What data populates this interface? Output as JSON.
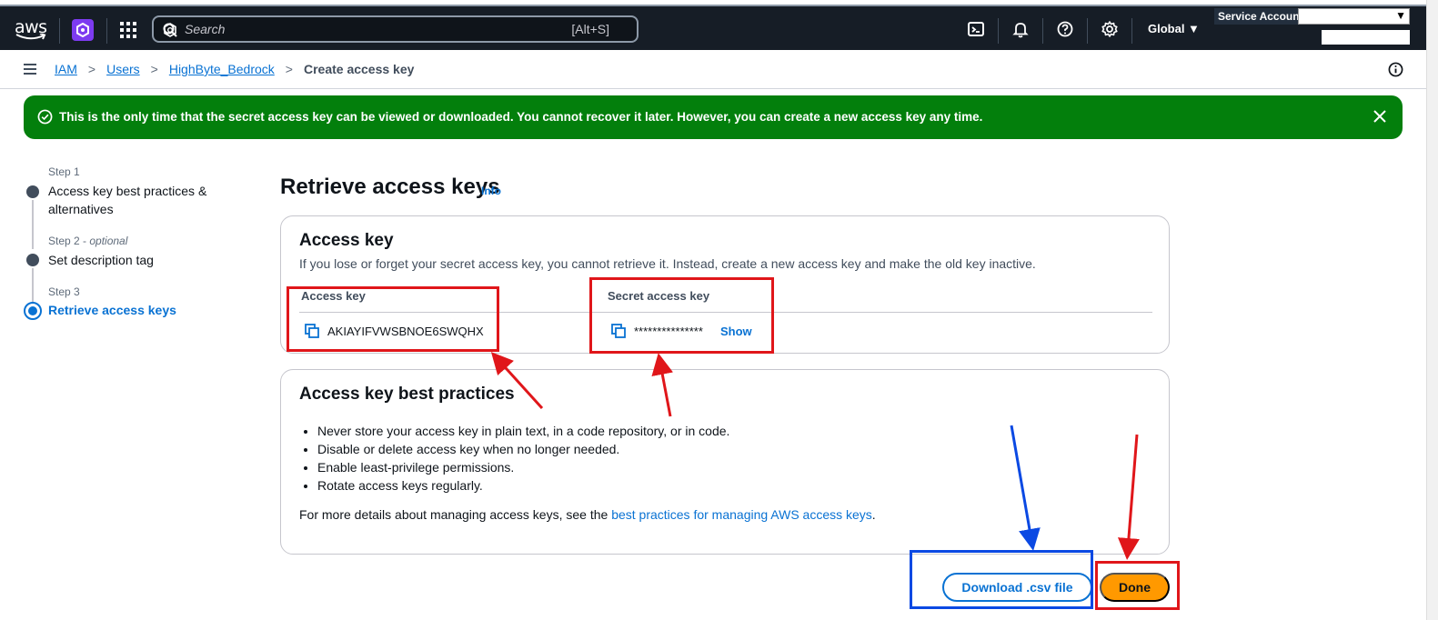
{
  "topnav": {
    "logo_text": "aws",
    "search_placeholder": "Search",
    "search_shortcut": "[Alt+S]",
    "region": "Global ▼",
    "account_label": "Service Account",
    "account_dropdown_arrow": "▼"
  },
  "breadcrumb": {
    "items": [
      "IAM",
      "Users",
      "HighByte_Bedrock"
    ],
    "current": "Create access key",
    "separator": ">"
  },
  "flash": {
    "message": "This is the only time that the secret access key can be viewed or downloaded. You cannot recover it later. However, you can create a new access key any time."
  },
  "steps": [
    {
      "label": "Step 1",
      "title_line1": "Access key best practices &",
      "title_line2": "alternatives"
    },
    {
      "label": "Step 2 - ",
      "label_optional": "optional",
      "title_line1": "Set description tag"
    },
    {
      "label": "Step 3",
      "title_line1": "Retrieve access keys"
    }
  ],
  "main": {
    "title": "Retrieve access keys",
    "info_link": "Info",
    "access_key_card": {
      "heading": "Access key",
      "description": "If you lose or forget your secret access key, you cannot retrieve it. Instead, create a new access key and make the old key inactive.",
      "col_access_key": "Access key",
      "col_secret_key": "Secret access key",
      "access_key_value": "AKIAYIFVWSBNOE6SWQHX",
      "secret_key_masked": "***************",
      "show_label": "Show"
    },
    "best_practices_card": {
      "heading": "Access key best practices",
      "items": [
        "Never store your access key in plain text, in a code repository, or in code.",
        "Disable or delete access key when no longer needed.",
        "Enable least-privilege permissions.",
        "Rotate access keys regularly."
      ],
      "more_prefix": "For more details about managing access keys, see the ",
      "more_link": "best practices for managing AWS access keys",
      "more_suffix": "."
    },
    "download_button": "Download .csv file",
    "done_button": "Done"
  },
  "colors": {
    "nav_bg": "#161d26",
    "flash_green": "#037f0c",
    "link_blue": "#0972d3",
    "primary_orange": "#ff9900",
    "annotation_red": "#e0161a",
    "annotation_blue": "#0b49e3"
  }
}
